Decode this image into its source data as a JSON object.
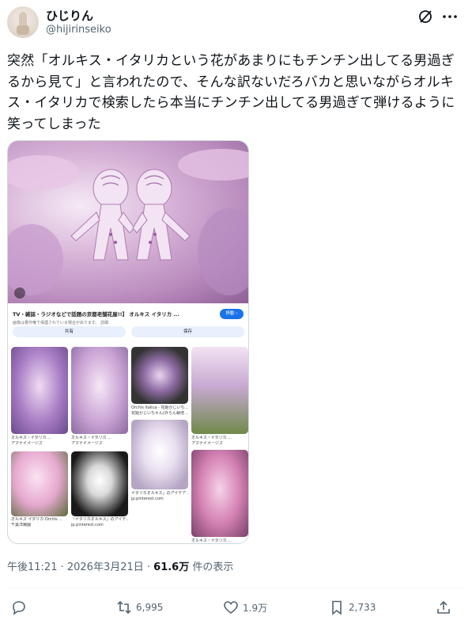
{
  "author": {
    "display_name": "ひじりん",
    "handle": "@hijirinseiko"
  },
  "post": {
    "text": "突然「オルキス・イタリカという花があまりにもチンチン出してる男過ぎるから見て」と言われたので、そんな訳ないだろバカと思いながらオルキス・イタリカで検索したら本当にチンチン出してる男過ぎて弾けるように笑ってしまった"
  },
  "media": {
    "result_title": "TV・雑誌・ラジオなどで話題の京都老舗花屋!!】 オルキス イタリカ ...",
    "result_subtitle": "画像は著作権で保護されている場合があります。 詳細",
    "visit_label": "移動 ›",
    "share_label": "共有",
    "save_label": "保存",
    "captions": {
      "c1a": "オルキス・イタリカ ...",
      "c1b": "アマナイメージズ",
      "c2a": "オルキス・イタリカ ...",
      "c2b": "アマナイメージズ",
      "c3a": "Orchis italica - 花姫かじいち...",
      "c3b": "花姫かじいちゃん(外らん栽培 ...",
      "c4a": "オルキス・イタリカ ...",
      "c4b": "アマナイメージズ",
      "c5a": "オルキス イタリカ Orchis ...",
      "c5b": "千葉洋蘭園",
      "c6a": "「イタリカオルキス」のアイデ...",
      "c6b": "jp.pinterest.com",
      "c7a": "イタリカオルキス」のアイデア ...",
      "c7b": "jp.pinterest.com",
      "c8a": "オルキス・イタリカ ..."
    }
  },
  "meta": {
    "timestamp": "午後11:21 · 2026年3月21日 · ",
    "views_count": "61.6万",
    "views_label": " 件の表示"
  },
  "actions": {
    "retweets": "6,995",
    "likes": "1.9万",
    "bookmarks": "2,733"
  },
  "colors": {
    "text": "#0f1419",
    "secondary": "#536471",
    "orchid": "#c89ad0",
    "link_blue": "#1a73e8"
  },
  "icons": [
    "grok-icon",
    "more-icon",
    "reply-icon",
    "retweet-icon",
    "like-icon",
    "bookmark-icon",
    "share-icon",
    "lens-icon"
  ]
}
